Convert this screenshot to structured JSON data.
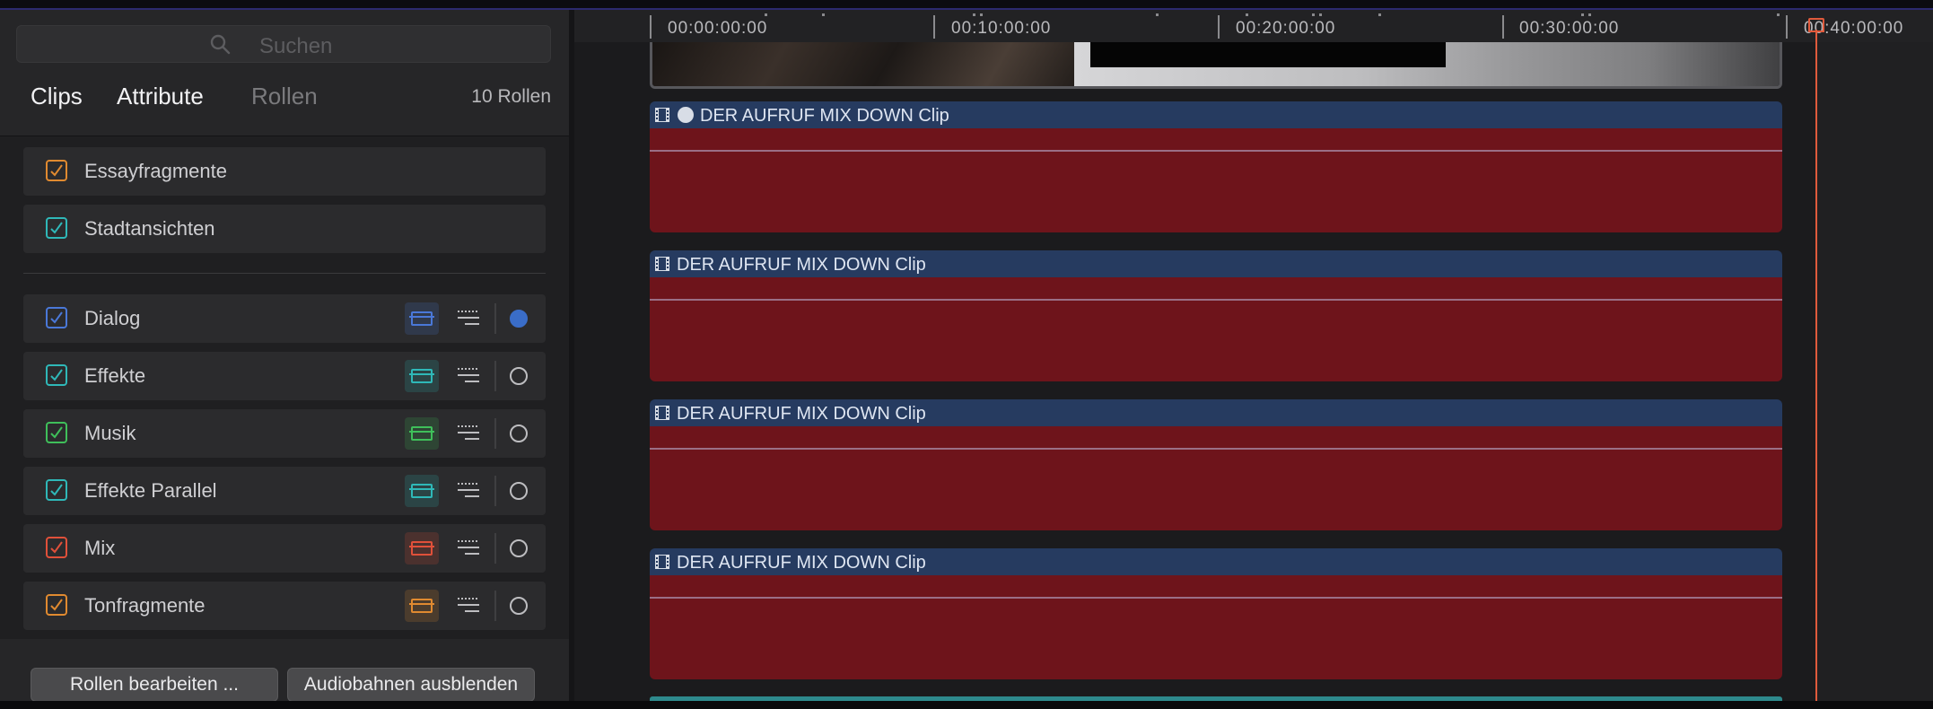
{
  "search": {
    "placeholder": "Suchen",
    "icon": "search-icon"
  },
  "tabs": [
    {
      "label": "Clips",
      "active": true
    },
    {
      "label": "Attribute",
      "active": true
    },
    {
      "label": "Rollen",
      "active": false
    }
  ],
  "roles_count": "10 Rollen",
  "video_roles": [
    {
      "label": "Essayfragmente",
      "checked": true,
      "color": "#e08a30"
    },
    {
      "label": "Stadtansichten",
      "checked": true,
      "color": "#2fb8b8"
    }
  ],
  "audio_roles": [
    {
      "label": "Dialog",
      "checked": true,
      "color": "#4a78d8",
      "focused": true
    },
    {
      "label": "Effekte",
      "checked": true,
      "color": "#2fb8b8",
      "focused": false
    },
    {
      "label": "Musik",
      "checked": true,
      "color": "#3fbf5a",
      "focused": false
    },
    {
      "label": "Effekte Parallel",
      "checked": true,
      "color": "#2fb8b8",
      "focused": false
    },
    {
      "label": "Mix",
      "checked": true,
      "color": "#e0503a",
      "focused": false
    },
    {
      "label": "Tonfragmente",
      "checked": true,
      "color": "#e08a30",
      "focused": false
    }
  ],
  "buttons": {
    "edit_roles": "Rollen bearbeiten ...",
    "hide_audio_lanes": "Audiobahnen ausblenden"
  },
  "timeline": {
    "timecodes": [
      "00:00:00:00",
      "00:10:00:00",
      "00:20:00:00",
      "00:30:00:00",
      "00:40:00:00"
    ],
    "clips": [
      {
        "title": "DER AUFRUF MIX DOWN Clip",
        "has_compound_icon": true
      },
      {
        "title": "DER AUFRUF MIX DOWN Clip",
        "has_compound_icon": false
      },
      {
        "title": "DER AUFRUF MIX DOWN Clip",
        "has_compound_icon": false
      },
      {
        "title": "DER AUFRUF MIX DOWN Clip",
        "has_compound_icon": false
      }
    ],
    "colors": {
      "audio_clip": "#6e141b",
      "clip_header": "#263b60",
      "playhead": "#e05a3c"
    }
  }
}
